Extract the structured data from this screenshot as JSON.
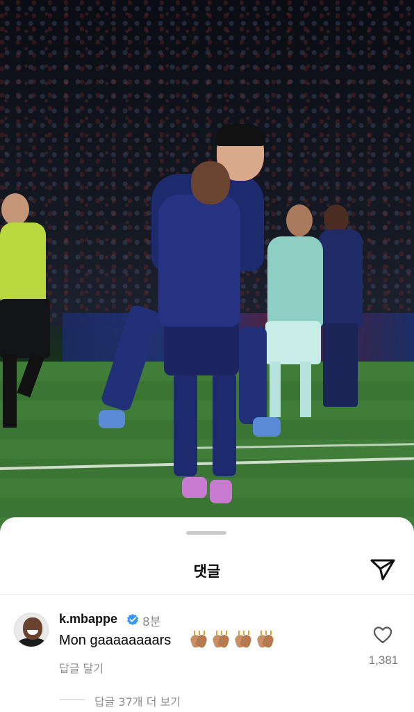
{
  "post": {
    "photo_subject": ""
  },
  "comments_sheet": {
    "title": "댓글"
  },
  "comment": {
    "username": "k.mbappe",
    "verified": true,
    "time": "8분",
    "text": "Mon gaaaaaaaars",
    "emoji": [
      "👏🏽",
      "👏🏽",
      "👏🏽",
      "👏🏽"
    ],
    "reply_label": "답글 달기",
    "likes": "1,381",
    "view_more_replies": "답글 37개 더 보기"
  },
  "icons": {
    "share": "paper-plane-icon",
    "like": "heart-icon",
    "verified": "verified-badge-icon"
  },
  "colors": {
    "verified_blue": "#3897f0",
    "secondary_text": "#8e8e8e"
  }
}
